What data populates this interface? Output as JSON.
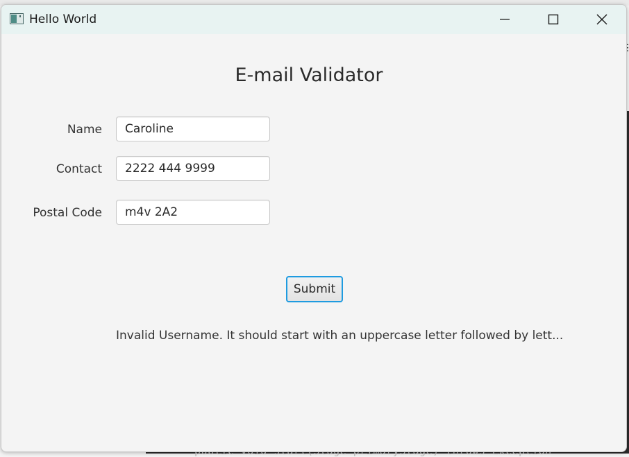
{
  "window": {
    "title": "Hello World"
  },
  "form": {
    "heading": "E-mail Validator",
    "fields": [
      {
        "label": "Name",
        "value": "Caroline"
      },
      {
        "label": "Contact",
        "value": "2222 444 9999"
      },
      {
        "label": "Postal Code",
        "value": "m4v 2A2"
      }
    ],
    "submit_label": "Submit",
    "message": "Invalid Username. It should start with an uppercase letter followed by lett..."
  },
  "background": {
    "code_line": "public void start(Stage primaryStage) throws Exception"
  },
  "colors": {
    "titlebar": "#e8f3f2",
    "focus_border": "#1e9be0",
    "window_bg": "#f4f4f4"
  }
}
